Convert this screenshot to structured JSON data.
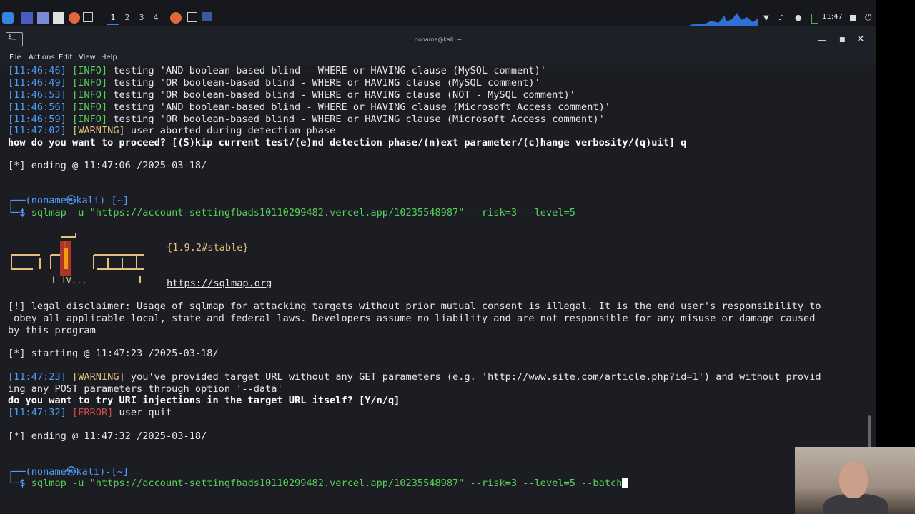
{
  "panel": {
    "workspaces": [
      "1",
      "2",
      "3",
      "4"
    ],
    "clock": "11:47"
  },
  "window": {
    "title": "noname@kali: ~",
    "menus": [
      "File",
      "Actions",
      "Edit",
      "View",
      "Help"
    ]
  },
  "terminal": {
    "lines": [
      {
        "ts": "[11:46:46]",
        "tag": "[INFO]",
        "text": " testing 'AND boolean-based blind - WHERE or HAVING clause (MySQL comment)'"
      },
      {
        "ts": "[11:46:49]",
        "tag": "[INFO]",
        "text": " testing 'OR boolean-based blind - WHERE or HAVING clause (MySQL comment)'"
      },
      {
        "ts": "[11:46:53]",
        "tag": "[INFO]",
        "text": " testing 'OR boolean-based blind - WHERE or HAVING clause (NOT - MySQL comment)'"
      },
      {
        "ts": "[11:46:56]",
        "tag": "[INFO]",
        "text": " testing 'AND boolean-based blind - WHERE or HAVING clause (Microsoft Access comment)'"
      },
      {
        "ts": "[11:46:59]",
        "tag": "[INFO]",
        "text": " testing 'OR boolean-based blind - WHERE or HAVING clause (Microsoft Access comment)'"
      },
      {
        "ts": "[11:47:02]",
        "tag": "[WARNING]",
        "text": " user aborted during detection phase"
      }
    ],
    "proceed_prompt": "how do you want to proceed? [(S)kip current test/(e)nd detection phase/(n)ext parameter/(c)hange verbosity/(q)uit] q",
    "ending1": "[*] ending @ 11:47:06 /2025-03-18/",
    "prompt1_top": "┌──(noname㉿kali)-[~]",
    "prompt1_cmd": "sqlmap -u \"https://account-settingfbads10110299482.vercel.app/10235548987\" --risk=3 --level=5",
    "version": "{1.9.2#stable}",
    "url": "https://sqlmap.org",
    "disclaimer1": "[!] legal disclaimer: Usage of sqlmap for attacking targets without prior mutual consent is illegal. It is the end user's responsibility to",
    "disclaimer2": " obey all applicable local, state and federal laws. Developers assume no liability and are not responsible for any misuse or damage caused",
    "disclaimer3": "by this program",
    "starting": "[*] starting @ 11:47:23 /2025-03-18/",
    "warn_ts": "[11:47:23]",
    "warn_tag": "[WARNING]",
    "warn_text1": " you've provided target URL without any GET parameters (e.g. 'http://www.site.com/article.php?id=1') and without provid",
    "warn_text2": "ing any POST parameters through option '--data'",
    "uri_prompt": "do you want to try URI injections in the target URL itself? [Y/n/q]",
    "err_ts": "[11:47:32]",
    "err_tag": "[ERROR]",
    "err_text": " user quit",
    "ending2": "[*] ending @ 11:47:32 /2025-03-18/",
    "prompt2_top": "┌──(noname㉿kali)-[~]",
    "prompt2_cmd": "sqlmap -u \"https://account-settingfbads10110299482.vercel.app/10235548987\" --risk=3 --level=5 --batch",
    "prompt_corner": "└─",
    "prompt_dollar": "$"
  }
}
